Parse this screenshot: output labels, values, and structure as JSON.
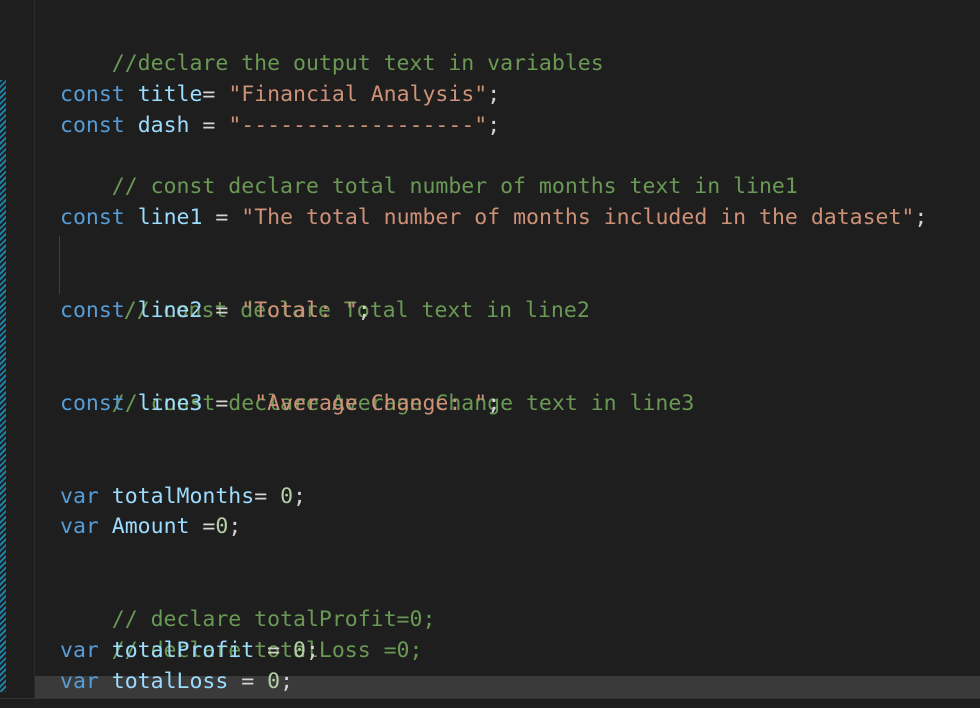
{
  "editor": {
    "lines": [
      {
        "comment": "//declare the output text in variables"
      },
      {
        "kw": "const",
        "name": "title",
        "op": "=",
        "value": "\"Financial Analysis\"",
        "end": ";"
      },
      {
        "kw": "const",
        "name": "dash",
        "op": "=",
        "value": "\"------------------\"",
        "end": ";"
      },
      {
        "comment": "// const declare total number of months text in line1"
      },
      {
        "kw": "const",
        "name": "line1",
        "op": "=",
        "value": "\"The total number of months included in the dataset\"",
        "end": ";"
      },
      {
        "comment": "// const declare Total text in line2"
      },
      {
        "kw": "const",
        "name": "line2",
        "op": "=",
        "value": "\"Total: \"",
        "end": ";"
      },
      {
        "comment": "// const declare Average Change text in line3"
      },
      {
        "kw": "const",
        "name": "line3",
        "op": "=",
        "value": "\"Average Change: \"",
        "end": ";"
      },
      {
        "kw": "var",
        "name": "totalMonths",
        "op": "=",
        "value": "0",
        "end": ";"
      },
      {
        "kw": "var",
        "name": "Amount",
        "op": "=",
        "value": "0",
        "end": ";"
      },
      {
        "comment": "// declare totalProfit=0;"
      },
      {
        "comment": "// declare totalLoss =0;"
      },
      {
        "kw": "var",
        "name": "totalProfit",
        "op": "=",
        "value": "0",
        "end": ";"
      },
      {
        "kw": "var",
        "name": "totalLoss",
        "op": "=",
        "value": "0",
        "end": ";"
      }
    ]
  },
  "colors": {
    "background": "#1e1e1e",
    "keyword": "#569cd6",
    "variable": "#9cdcfe",
    "string": "#ce9178",
    "comment": "#6a9955",
    "number": "#b5cea8"
  }
}
